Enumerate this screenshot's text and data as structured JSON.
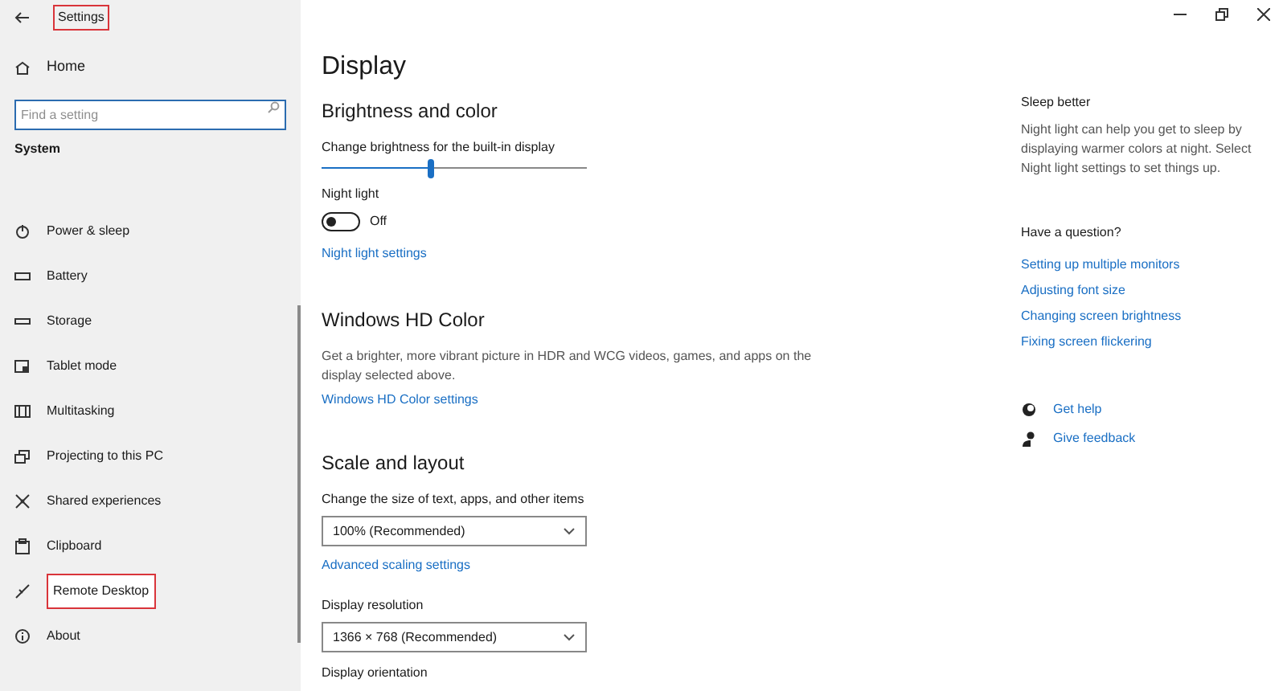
{
  "window": {
    "title": "Settings",
    "title_highlighted": true
  },
  "sidebar": {
    "home": "Home",
    "search": {
      "placeholder": "Find a setting"
    },
    "section": "System",
    "items": [
      {
        "label": "Power & sleep",
        "highlighted": false
      },
      {
        "label": "Battery",
        "highlighted": false
      },
      {
        "label": "Storage",
        "highlighted": false
      },
      {
        "label": "Tablet mode",
        "highlighted": false
      },
      {
        "label": "Multitasking",
        "highlighted": false
      },
      {
        "label": "Projecting to this PC",
        "highlighted": false
      },
      {
        "label": "Shared experiences",
        "highlighted": false
      },
      {
        "label": "Clipboard",
        "highlighted": false
      },
      {
        "label": "Remote Desktop",
        "highlighted": true
      },
      {
        "label": "About",
        "highlighted": false
      }
    ]
  },
  "main": {
    "title": "Display",
    "brightness": {
      "heading": "Brightness and color",
      "slider_label": "Change brightness for the built-in display",
      "level": 0.41,
      "night_light_label": "Night light",
      "night_light": {
        "on": false,
        "state_text": "Off"
      },
      "link": "Night light settings"
    },
    "hd_color": {
      "heading": "Windows HD Color",
      "description": "Get a brighter, more vibrant picture in HDR and WCG videos, games, and apps on the display selected above.",
      "link": "Windows HD Color settings"
    },
    "scale": {
      "heading": "Scale and layout",
      "size_label": "Change the size of text, apps, and other items",
      "size_value": "100% (Recommended)",
      "link": "Advanced scaling settings",
      "resolution_label": "Display resolution",
      "resolution_value": "1366 × 768 (Recommended)",
      "orientation_label": "Display orientation"
    }
  },
  "aside": {
    "heading": "Sleep better",
    "text": "Night light can help you get to sleep by displaying warmer colors at night. Select Night light settings to set things up.",
    "question": "Have a question?",
    "links": [
      "Setting up multiple monitors",
      "Adjusting font size",
      "Changing screen brightness",
      "Fixing screen flickering"
    ],
    "actions": [
      {
        "label": "Get help"
      },
      {
        "label": "Give feedback"
      }
    ]
  }
}
